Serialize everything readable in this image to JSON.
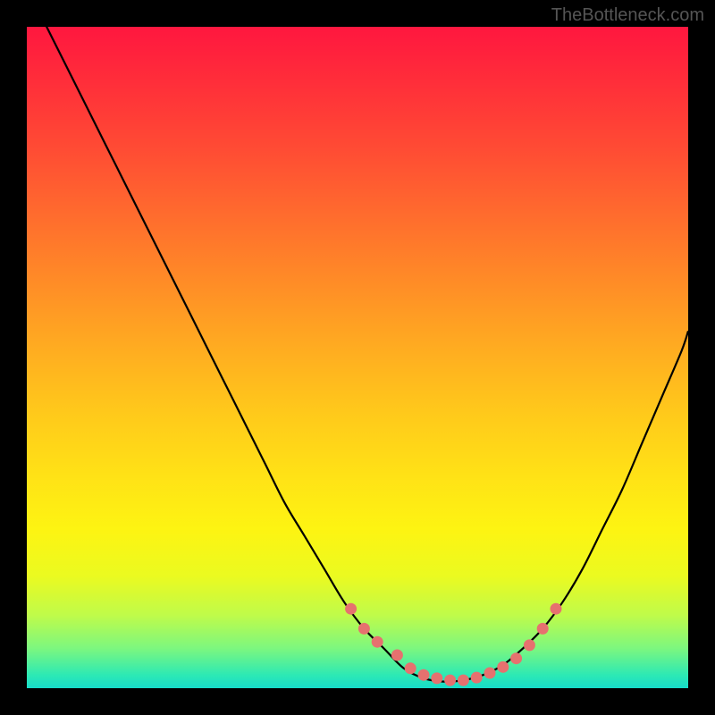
{
  "watermark": "TheBottleneck.com",
  "chart_data": {
    "type": "line",
    "title": "",
    "xlabel": "",
    "ylabel": "",
    "xlim": [
      0,
      100
    ],
    "ylim": [
      0,
      100
    ],
    "curve": {
      "x": [
        0,
        3,
        6,
        9,
        12,
        15,
        18,
        21,
        24,
        27,
        30,
        33,
        36,
        39,
        42,
        45,
        48,
        51,
        54,
        57,
        60,
        63,
        66,
        69,
        72,
        75,
        78,
        81,
        84,
        87,
        90,
        93,
        96,
        99,
        100
      ],
      "y": [
        106,
        100,
        94,
        88,
        82,
        76,
        70,
        64,
        58,
        52,
        46,
        40,
        34,
        28,
        23,
        18,
        13,
        9,
        6,
        3,
        1.5,
        1,
        1.2,
        2,
        3.5,
        6,
        9,
        13,
        18,
        24,
        30,
        37,
        44,
        51,
        54
      ]
    },
    "dots": {
      "x": [
        49,
        51,
        53,
        56,
        58,
        60,
        62,
        64,
        66,
        68,
        70,
        72,
        74,
        76,
        78,
        80
      ],
      "y": [
        12,
        9,
        7,
        5,
        3,
        2,
        1.5,
        1.2,
        1.2,
        1.6,
        2.3,
        3.2,
        4.5,
        6.5,
        9,
        12
      ]
    },
    "dot_color": "#E6716F",
    "curve_color": "#000000",
    "curve_width": 2.2
  }
}
